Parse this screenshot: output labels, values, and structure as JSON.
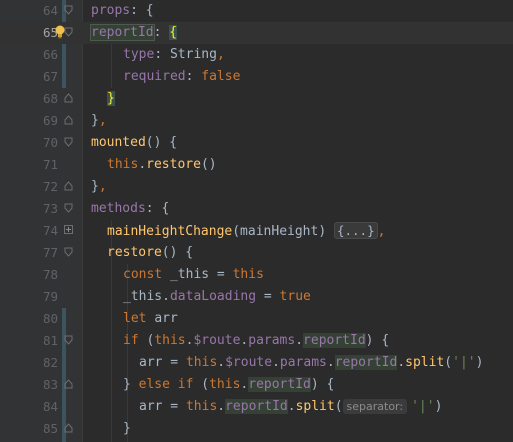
{
  "line_numbers": [
    "64",
    "65",
    "66",
    "67",
    "68",
    "69",
    "70",
    "71",
    "72",
    "73",
    "74",
    "77",
    "78",
    "79",
    "80",
    "81",
    "82",
    "83",
    "84",
    "85"
  ],
  "code": {
    "props_key": "props",
    "colon": ":",
    "lbrace": "{",
    "rbrace": "}",
    "comma": ",",
    "reportId": "reportId",
    "type_key": "type",
    "string_type": "String",
    "required_key": "required",
    "false_kw": "false",
    "close_brace_comma": "},",
    "mounted": "mounted",
    "parens_brace": "() {",
    "this_kw": "this",
    "dot": ".",
    "restore": "restore",
    "call_end": "()",
    "methods_key": "methods",
    "mainHeightChange": "mainHeightChange",
    "mainHeight_param": "(mainHeight)",
    "folded_body": "{...}",
    "const_kw": "const",
    "this_alias": "_this",
    "eq": " = ",
    "dataLoading": "dataLoading",
    "true_kw": "true",
    "let_kw": "let",
    "arr": "arr",
    "if_kw": "if",
    "else_kw": "else",
    "route": "$route",
    "params": "params",
    "split": "split",
    "pipe_str": "'|'",
    "separator_hint": "separator:",
    "open_paren": "(",
    "close_paren": ")",
    "close_paren_brace": ") {",
    "rbrace_space": "} "
  },
  "colors": {
    "keyword": "#cc7832",
    "function": "#ffc66d",
    "property": "#9876aa",
    "string": "#6a8759",
    "text": "#a9b7c6"
  },
  "icons": [
    "fold-arrow-icon",
    "intention-bulb-icon"
  ]
}
